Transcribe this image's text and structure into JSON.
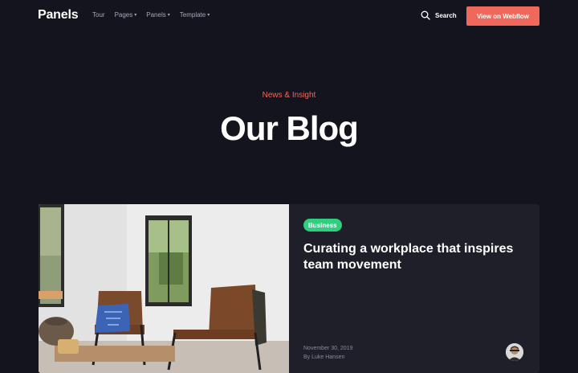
{
  "nav": {
    "logo": "Panels",
    "links": [
      {
        "label": "Tour",
        "dropdown": false
      },
      {
        "label": "Pages",
        "dropdown": true
      },
      {
        "label": "Panels",
        "dropdown": true
      },
      {
        "label": "Template",
        "dropdown": true
      }
    ],
    "search_label": "Search",
    "search_icon": "search-icon",
    "cta_label": "View on Webflow"
  },
  "hero": {
    "eyebrow": "News & Insight",
    "title": "Our Blog"
  },
  "featured_post": {
    "category": "Business",
    "title": "Curating a workplace that inspires team movement",
    "date": "November 30, 2019",
    "author": "By Luke Hansen"
  },
  "colors": {
    "background": "#14141f",
    "card": "#1f1f2a",
    "accent": "#f0685b",
    "badge": "#2fcf80"
  }
}
